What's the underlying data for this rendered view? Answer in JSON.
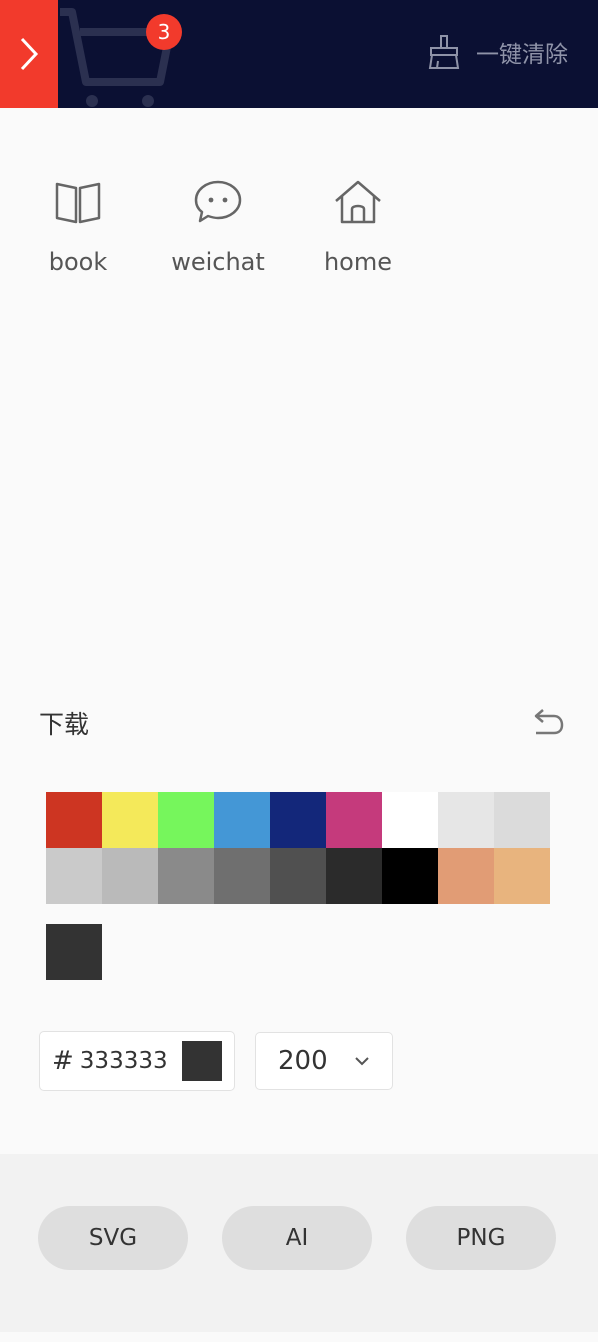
{
  "header": {
    "cart_count": "3",
    "clear_label": "一键清除"
  },
  "icons": [
    {
      "name": "book",
      "icon": "book-icon"
    },
    {
      "name": "weichat",
      "icon": "wechat-icon"
    },
    {
      "name": "home",
      "icon": "home-icon"
    }
  ],
  "download": {
    "title": "下载"
  },
  "palette": [
    "#cd3522",
    "#f4e95a",
    "#76f65c",
    "#4497d6",
    "#13277a",
    "#c53a7c",
    "#ffffff",
    "#e6e6e6",
    "#dbdbdb",
    "#cacaca",
    "#bababa",
    "#8a8a8a",
    "#6f6f6f",
    "#505050",
    "#2b2b2b",
    "#000000",
    "#e19c75",
    "#e8b47e"
  ],
  "selected_color": "#333333",
  "color_input": {
    "hash": "#",
    "value": "333333"
  },
  "size_select": {
    "value": "200"
  },
  "formats": [
    "SVG",
    "AI",
    "PNG"
  ],
  "colors": {
    "header_bg": "#0b1033",
    "accent": "#f23a2c"
  }
}
